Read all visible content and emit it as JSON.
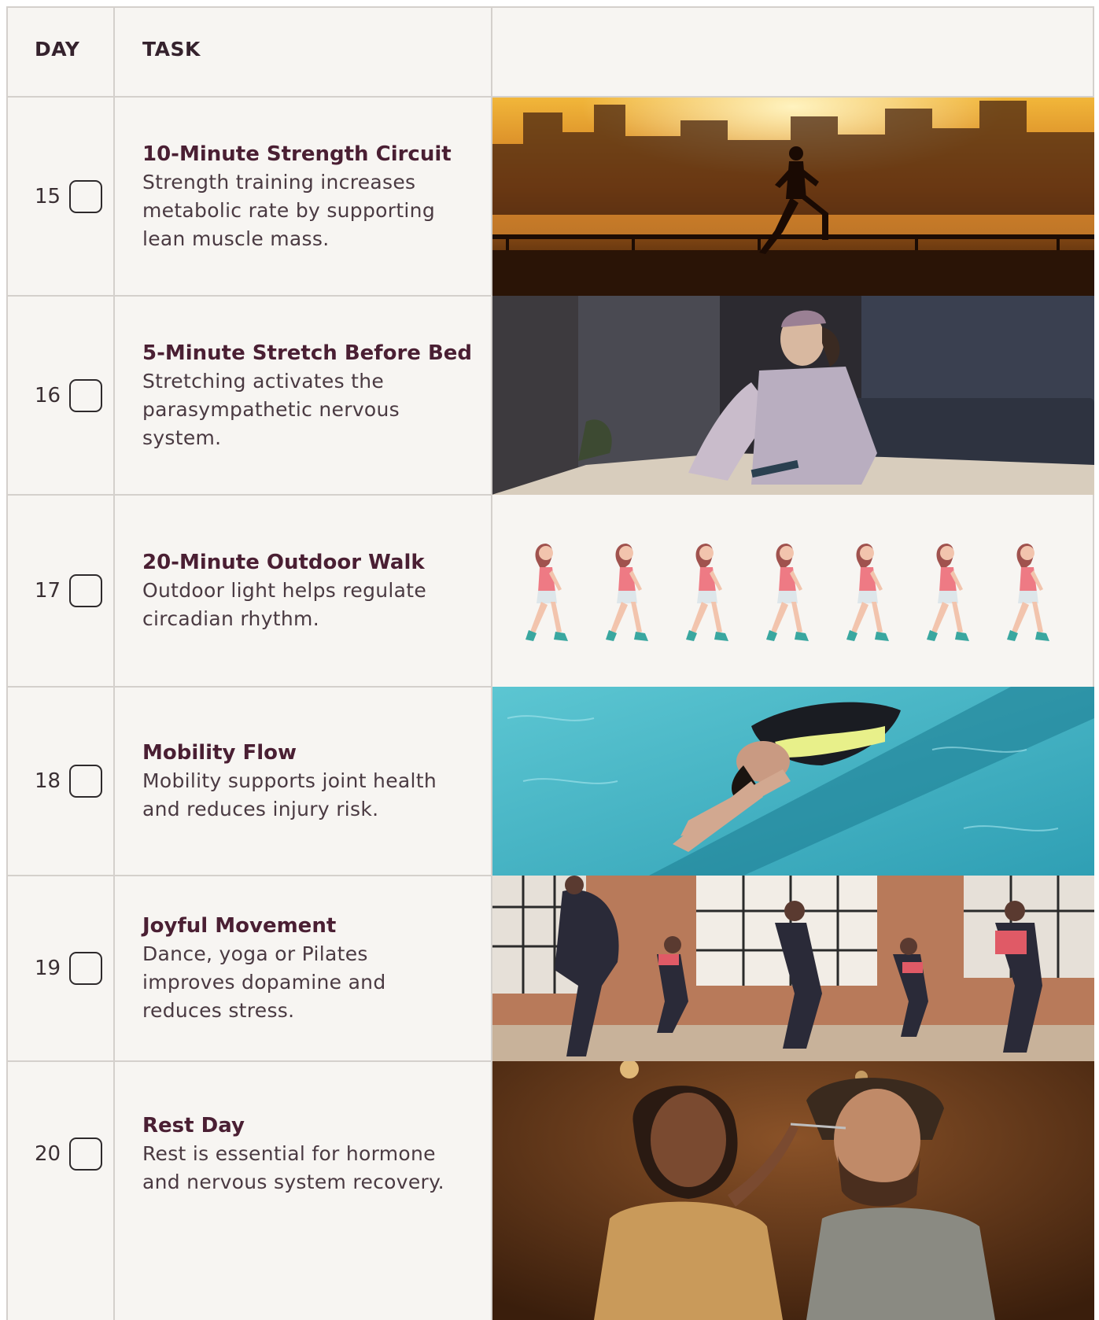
{
  "header": {
    "day_label": "DAY",
    "task_label": "TASK"
  },
  "rows": [
    {
      "day": "15",
      "title": "10-Minute Strength Circuit",
      "desc_lines": [
        "Strength training increases",
        "metabolic rate by supporting",
        "lean muscle mass."
      ],
      "image": "sunset-runner-photo"
    },
    {
      "day": "16",
      "title": "5-Minute Stretch Before Bed",
      "desc_lines": [
        "Stretching activates the",
        "parasympathetic nervous",
        "system."
      ],
      "image": "woman-stretching-in-bed-photo"
    },
    {
      "day": "17",
      "title": "20-Minute Outdoor Walk",
      "desc_lines": [
        "Outdoor light helps regulate",
        "circadian rhythm."
      ],
      "image": "walking-woman-illustration-sequence"
    },
    {
      "day": "18",
      "title": "Mobility Flow",
      "desc_lines": [
        "Mobility supports joint health",
        "and reduces injury risk."
      ],
      "image": "woman-floating-in-pool-photo"
    },
    {
      "day": "19",
      "title": "Joyful Movement",
      "desc_lines": [
        "Dance, yoga or Pilates",
        "improves dopamine and",
        "reduces stress."
      ],
      "image": "group-squat-class-photo"
    },
    {
      "day": "20",
      "title": "Rest Day",
      "desc_lines": [
        "Rest is essential for hormone",
        "and nervous system recovery."
      ],
      "image": "couple-sharing-meal-photo"
    }
  ],
  "colors": {
    "background": "#f7f5f2",
    "grid": "#d4d0cc",
    "title": "#4a1f33",
    "text": "#4a3a42"
  }
}
